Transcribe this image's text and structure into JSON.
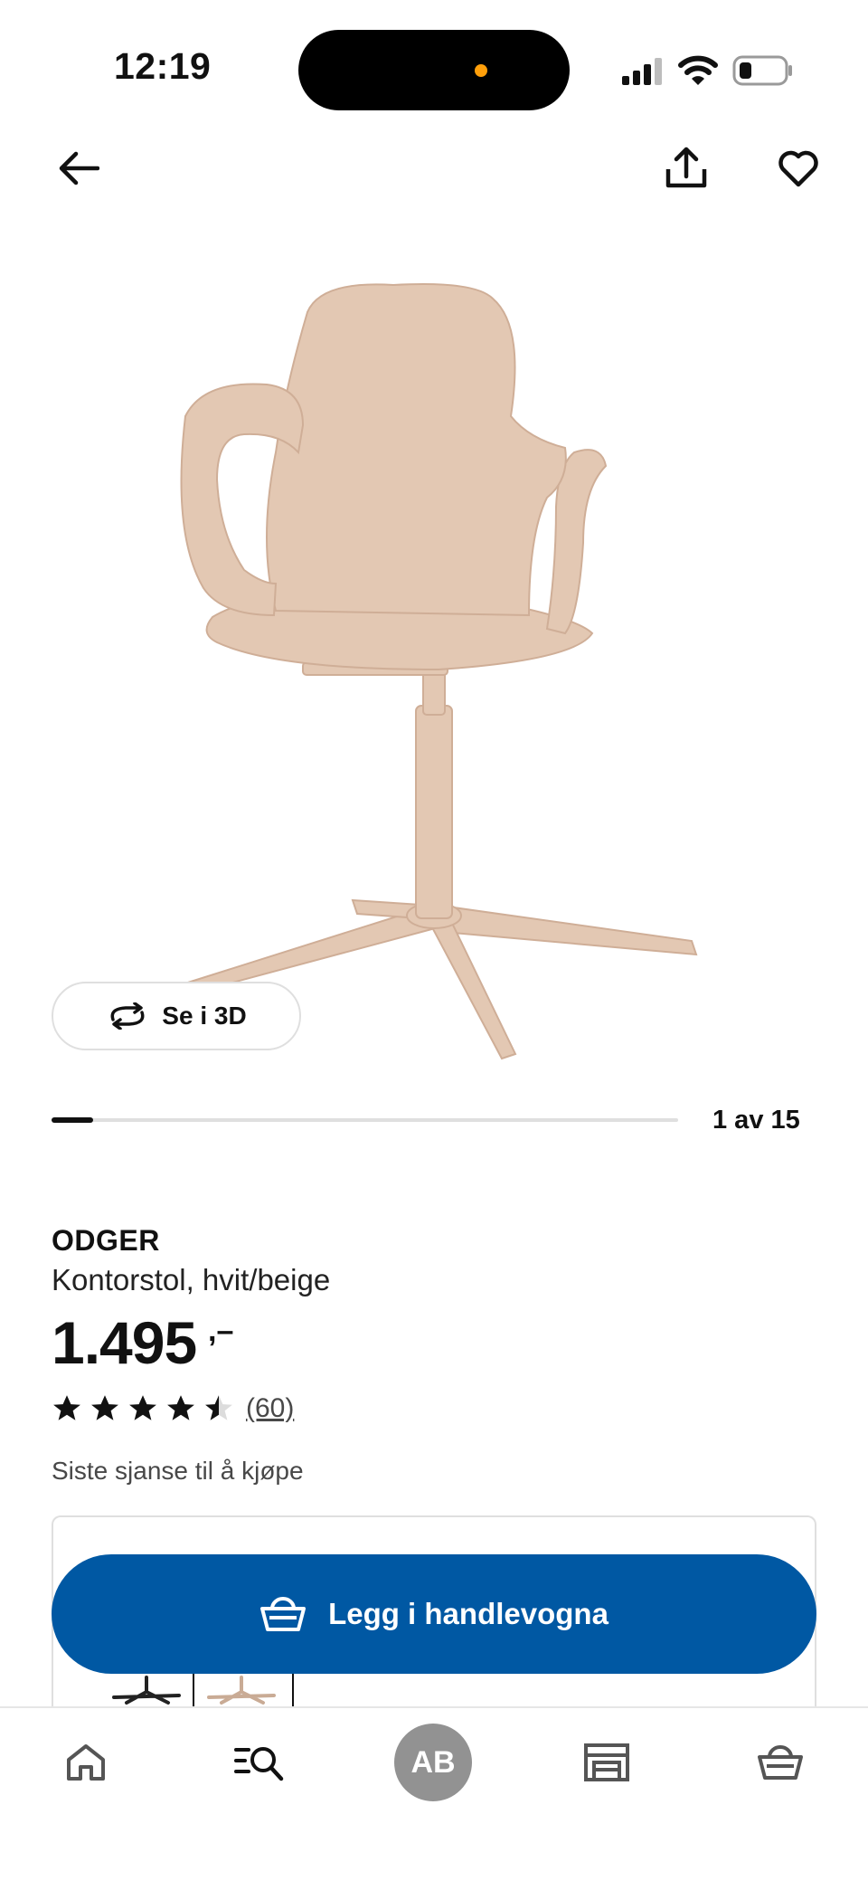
{
  "status_bar": {
    "time": "12:19"
  },
  "nav": {
    "back_icon": "arrow-left-icon",
    "share_icon": "share-icon",
    "favorite_icon": "heart-icon"
  },
  "gallery": {
    "view_3d_label": "Se i 3D",
    "counter": "1 av 15",
    "progress": 0.067
  },
  "product": {
    "name": "ODGER",
    "description": "Kontorstol, hvit/beige",
    "price": "1.495",
    "price_suffix": ",–",
    "rating": 4.5,
    "review_count": "(60)",
    "notice": "Siste sjanse til å kjøpe"
  },
  "cta": {
    "label": "Legg i handlevogna"
  },
  "tabbar": {
    "items": [
      {
        "icon": "home-icon"
      },
      {
        "icon": "search-list-icon"
      },
      {
        "label": "AB"
      },
      {
        "icon": "store-icon"
      },
      {
        "icon": "cart-icon"
      }
    ]
  },
  "colors": {
    "primary": "#0058a3",
    "text": "#111111",
    "muted": "#484848",
    "avatar": "#929292",
    "product_beige": "#e3c8b3"
  }
}
